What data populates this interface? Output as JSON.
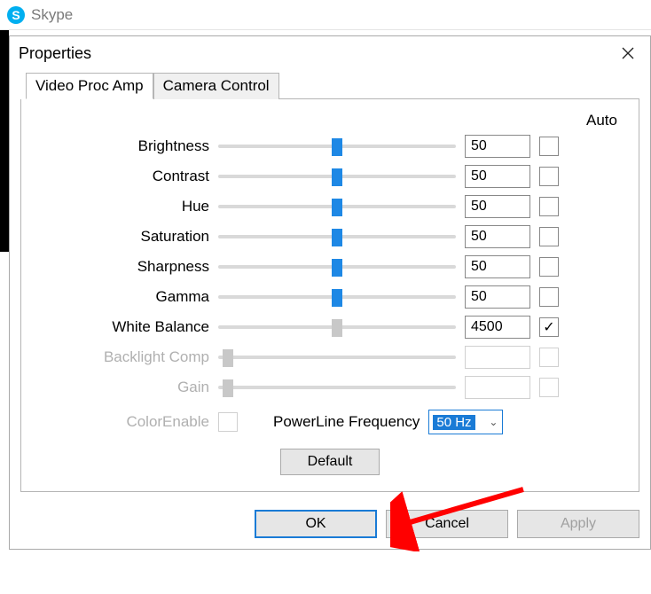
{
  "parent": {
    "title": "Skype",
    "icon_letter": "S"
  },
  "dialog": {
    "title": "Properties",
    "tabs": [
      "Video Proc Amp",
      "Camera Control"
    ],
    "active_tab": 0,
    "auto_header": "Auto",
    "sliders": [
      {
        "label": "Brightness",
        "value": "50",
        "pos": 0.5,
        "auto": false,
        "enabled": true
      },
      {
        "label": "Contrast",
        "value": "50",
        "pos": 0.5,
        "auto": false,
        "enabled": true
      },
      {
        "label": "Hue",
        "value": "50",
        "pos": 0.5,
        "auto": false,
        "enabled": true
      },
      {
        "label": "Saturation",
        "value": "50",
        "pos": 0.5,
        "auto": false,
        "enabled": true
      },
      {
        "label": "Sharpness",
        "value": "50",
        "pos": 0.5,
        "auto": false,
        "enabled": true
      },
      {
        "label": "Gamma",
        "value": "50",
        "pos": 0.5,
        "auto": false,
        "enabled": true
      },
      {
        "label": "White Balance",
        "value": "4500",
        "pos": 0.5,
        "auto": true,
        "enabled": true,
        "thumb_color": "#c8c8c8"
      },
      {
        "label": "Backlight Comp",
        "value": "",
        "pos": 0.02,
        "auto": false,
        "enabled": false
      },
      {
        "label": "Gain",
        "value": "",
        "pos": 0.02,
        "auto": false,
        "enabled": false
      }
    ],
    "color_enable_label": "ColorEnable",
    "powerline_label": "PowerLine Frequency",
    "powerline_value": "50 Hz",
    "default_label": "Default",
    "buttons": {
      "ok": "OK",
      "cancel": "Cancel",
      "apply": "Apply"
    }
  }
}
